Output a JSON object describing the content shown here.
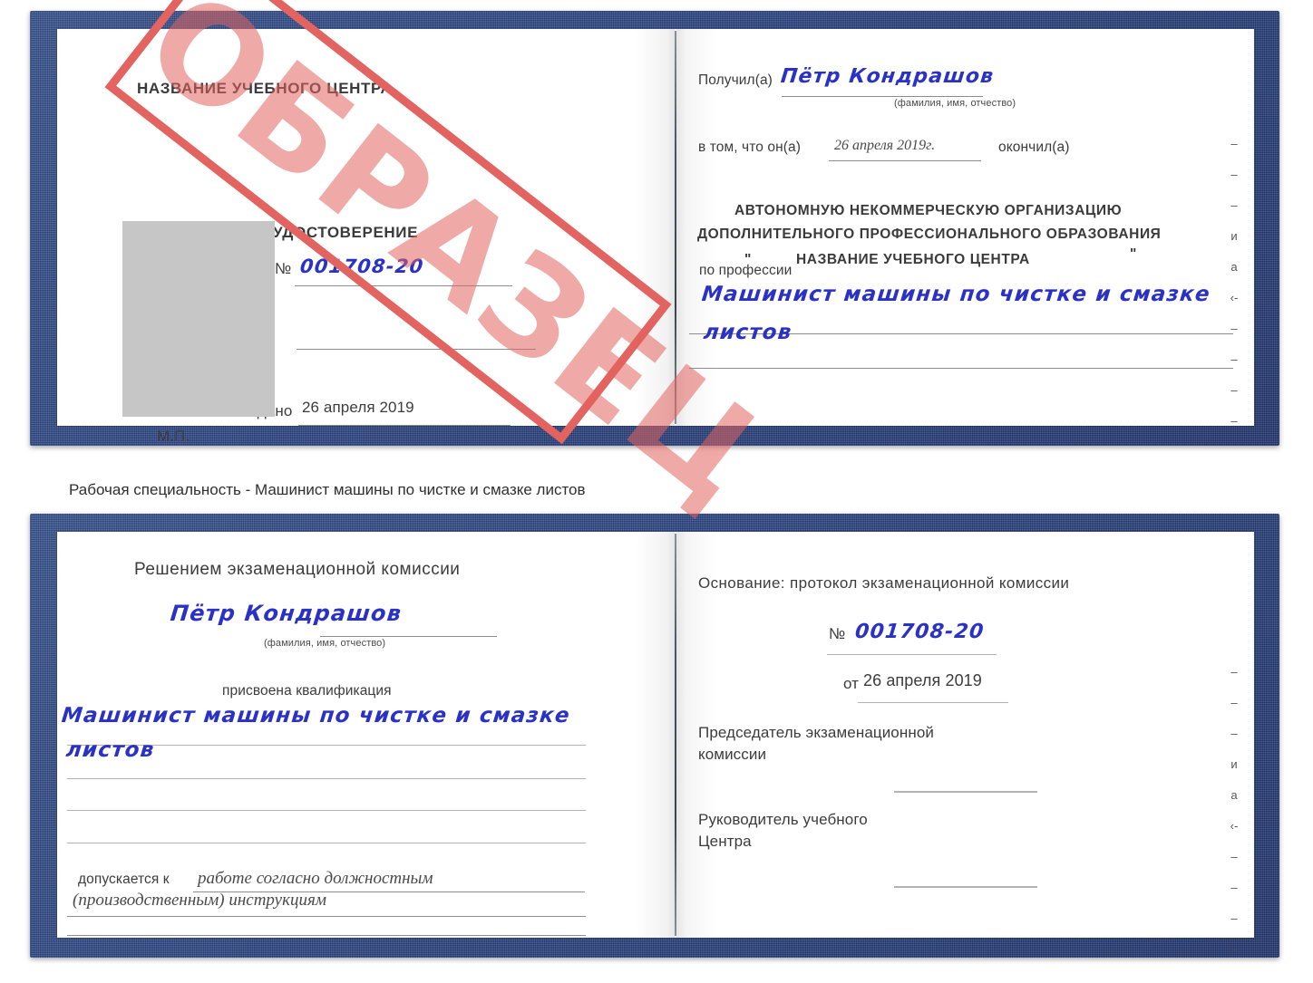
{
  "document": {
    "kind": "certificate-sample",
    "watermark": "ОБРАЗЕЦ",
    "accent_red": "#e2635f",
    "cover_blue": "#2a4485",
    "ink_blue": "#2a31c6"
  },
  "caption": "Рабочая специальность - Машинист машины по чистке и смазке листов",
  "top_certificate": {
    "left_page": {
      "center_name": "НАЗВАНИЕ УЧЕБНОГО ЦЕНТРА",
      "doc_title": "УДОСТОВЕРЕНИЕ",
      "number_label": "№",
      "number_value": "001708-20",
      "issued_label": "Выдано",
      "issued_value": "26 апреля 2019",
      "seal_label": "М.П."
    },
    "right_page": {
      "received_label": "Получил(а)",
      "received_value": "Пётр Кондрашов",
      "fio_hint": "(фамилия, имя, отчество)",
      "in_that_label": "в том, что он(а)",
      "in_that_value": "26 апреля 2019г.",
      "finished_label": "окончил(а)",
      "org_line1": "АВТОНОМНУЮ НЕКОММЕРЧЕСКУЮ ОРГАНИЗАЦИЮ",
      "org_line2": "ДОПОЛНИТЕЛЬНОГО ПРОФЕССИОНАЛЬНОГО ОБРАЗОВАНИЯ",
      "org_quote_open": "\"",
      "org_line3": "НАЗВАНИЕ УЧЕБНОГО ЦЕНТРА",
      "org_quote_close": "\"",
      "profession_label": "по профессии",
      "profession_value_line1": "Машинист машины по чистке и смазке",
      "profession_value_line2": "листов",
      "edge_glyphs": [
        "–",
        "–",
        "–",
        "и",
        "а",
        "‹-",
        "–",
        "–",
        "–",
        "–"
      ]
    }
  },
  "bottom_certificate": {
    "left_page": {
      "heading": "Решением экзаменационной комиссии",
      "name_value": "Пётр Кондрашов",
      "fio_hint": "(фамилия, имя, отчество)",
      "qualification_label": "присвоена квалификация",
      "qualification_value_line1": "Машинист машины по чистке и смазке",
      "qualification_value_line2": "листов",
      "admitted_label": "допускается к",
      "admitted_value_line1": "работе согласно должностным",
      "admitted_value_line2": "(производственным) инструкциям"
    },
    "right_page": {
      "basis_label": "Основание: протокол экзаменационной комиссии",
      "number_label": "№",
      "number_value": "001708-20",
      "date_label": "от",
      "date_value": "26 апреля 2019",
      "chairman_line1": "Председатель экзаменационной",
      "chairman_line2": "комиссии",
      "head_line1": "Руководитель учебного",
      "head_line2": "Центра",
      "edge_glyphs": [
        "–",
        "–",
        "–",
        "и",
        "а",
        "‹-",
        "–",
        "–",
        "–",
        "–"
      ]
    }
  }
}
